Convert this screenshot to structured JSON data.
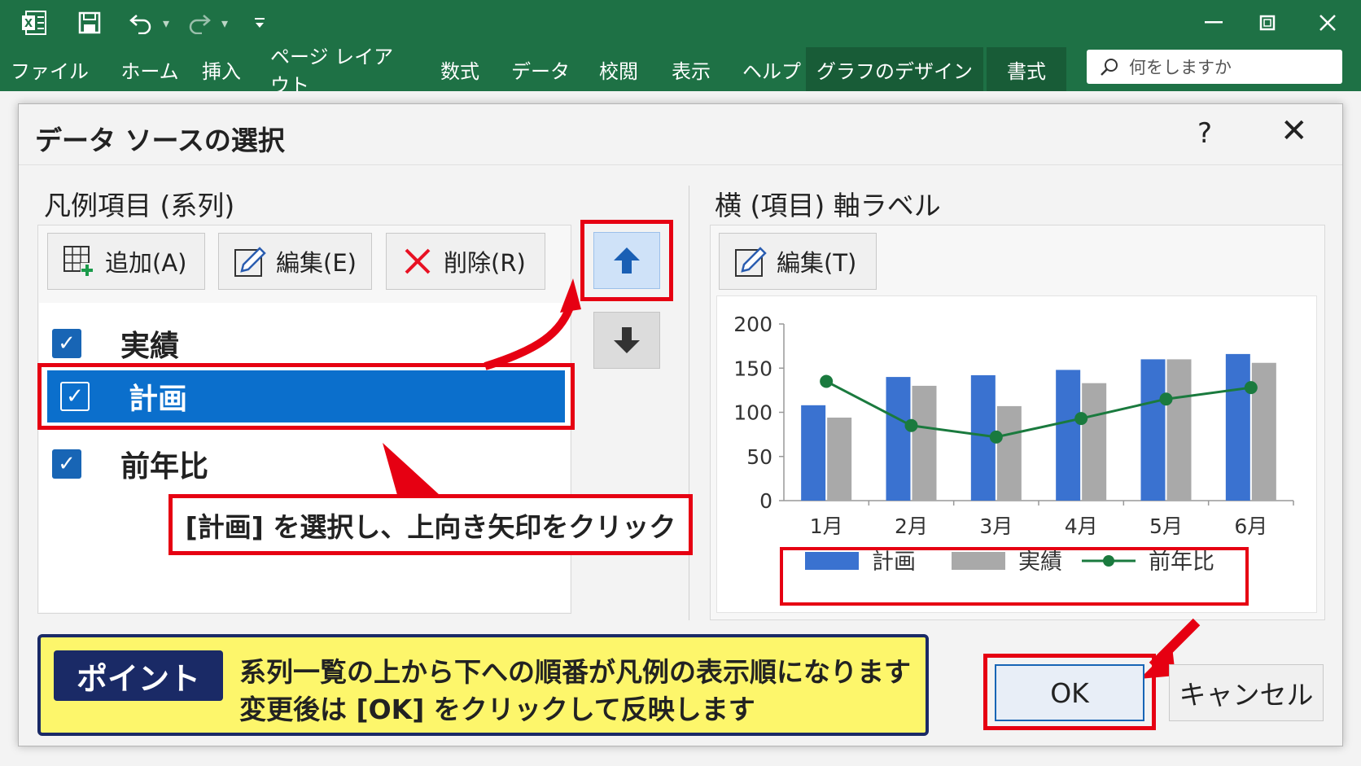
{
  "ribbon": {
    "qat_more": "▾",
    "tabs": [
      "ファイル",
      "ホーム",
      "挿入",
      "ページ レイアウト",
      "数式",
      "データ",
      "校閲",
      "表示",
      "ヘルプ",
      "グラフのデザイン",
      "書式"
    ],
    "search_placeholder": "何をしますか",
    "colors": {
      "bg": "#1e7145",
      "active_tab": "#185c37"
    }
  },
  "dialog": {
    "title": "データ ソースの選択",
    "help": "?",
    "close": "✕",
    "legend_section": {
      "title": "凡例項目 (系列)",
      "add_label": "追加(A)",
      "edit_label": "編集(E)",
      "delete_label": "削除(R)",
      "items": [
        {
          "label": "実績",
          "checked": true,
          "selected": false
        },
        {
          "label": "計画",
          "checked": true,
          "selected": true
        },
        {
          "label": "前年比",
          "checked": true,
          "selected": false
        }
      ]
    },
    "axis_section": {
      "title": "横 (項目) 軸ラベル",
      "edit_label": "編集(T)"
    },
    "ok_label": "OK",
    "cancel_label": "キャンセル"
  },
  "annotation": {
    "callout": "[計画] を選択し、上向き矢印をクリック",
    "point_tag": "ポイント",
    "point_line1": "系列一覧の上から下への順番が凡例の表示順になります",
    "point_line2": "変更後は [OK] をクリックして反映します",
    "accent_red": "#e60012",
    "point_bg": "#fdf66b",
    "point_navy": "#1a2a66"
  },
  "chart_data": {
    "type": "bar",
    "categories": [
      "1月",
      "2月",
      "3月",
      "4月",
      "5月",
      "6月"
    ],
    "series": [
      {
        "name": "計画",
        "type": "bar",
        "color": "#3a72d0",
        "values": [
          108,
          140,
          142,
          148,
          160,
          166
        ]
      },
      {
        "name": "実績",
        "type": "bar",
        "color": "#a9a9a9",
        "values": [
          94,
          130,
          107,
          133,
          160,
          156
        ]
      },
      {
        "name": "前年比",
        "type": "line",
        "color": "#1a7a3e",
        "values": [
          135,
          85,
          72,
          93,
          115,
          128
        ]
      }
    ],
    "y_ticks": [
      "200",
      "150",
      "100",
      "50",
      "0"
    ],
    "ylim": [
      0,
      200
    ],
    "legend": [
      "計画",
      "実績",
      "前年比"
    ],
    "legend_position": "bottom",
    "grid": false
  }
}
